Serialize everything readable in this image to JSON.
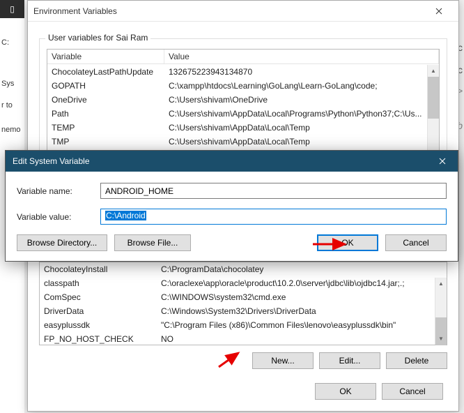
{
  "bg": {
    "left_c": "C:",
    "left_sys": "Sys",
    "left_rto": "r to",
    "left_nemo": "nemo",
    "right_nsic": "nsic",
    "right_sc": "Sc",
    "right_b": "<b>",
    "right_iab": "riab"
  },
  "envwin": {
    "title": "Environment Variables",
    "group_user_label": "User variables for Sai Ram",
    "head_var": "Variable",
    "head_val": "Value",
    "user_rows": [
      {
        "v": "ChocolateyLastPathUpdate",
        "val": "132675223943134870"
      },
      {
        "v": "GOPATH",
        "val": "C:\\xampp\\htdocs\\Learning\\GoLang\\Learn-GoLang\\code;"
      },
      {
        "v": "OneDrive",
        "val": "C:\\Users\\shivam\\OneDrive"
      },
      {
        "v": "Path",
        "val": "C:\\Users\\shivam\\AppData\\Local\\Programs\\Python\\Python37;C:\\Us..."
      },
      {
        "v": "TEMP",
        "val": "C:\\Users\\shivam\\AppData\\Local\\Temp"
      },
      {
        "v": "TMP",
        "val": "C:\\Users\\shivam\\AppData\\Local\\Temp"
      }
    ],
    "sys_rows": [
      {
        "v": "ChocolateyInstall",
        "val": "C:\\ProgramData\\chocolatey"
      },
      {
        "v": "classpath",
        "val": "C:\\oraclexe\\app\\oracle\\product\\10.2.0\\server\\jdbc\\lib\\ojdbc14.jar;.;"
      },
      {
        "v": "ComSpec",
        "val": "C:\\WINDOWS\\system32\\cmd.exe"
      },
      {
        "v": "DriverData",
        "val": "C:\\Windows\\System32\\Drivers\\DriverData"
      },
      {
        "v": "easyplussdk",
        "val": "\"C:\\Program Files (x86)\\Common Files\\lenovo\\easyplussdk\\bin\""
      },
      {
        "v": "FP_NO_HOST_CHECK",
        "val": "NO"
      }
    ],
    "btn_new": "New...",
    "btn_edit": "Edit...",
    "btn_delete": "Delete",
    "btn_ok": "OK",
    "btn_cancel": "Cancel"
  },
  "editmodal": {
    "title": "Edit System Variable",
    "label_name": "Variable name:",
    "label_value": "Variable value:",
    "value_name": "ANDROID_HOME",
    "value_value": "C:\\Android",
    "btn_browse_dir": "Browse Directory...",
    "btn_browse_file": "Browse File...",
    "btn_ok": "OK",
    "btn_cancel": "Cancel"
  }
}
